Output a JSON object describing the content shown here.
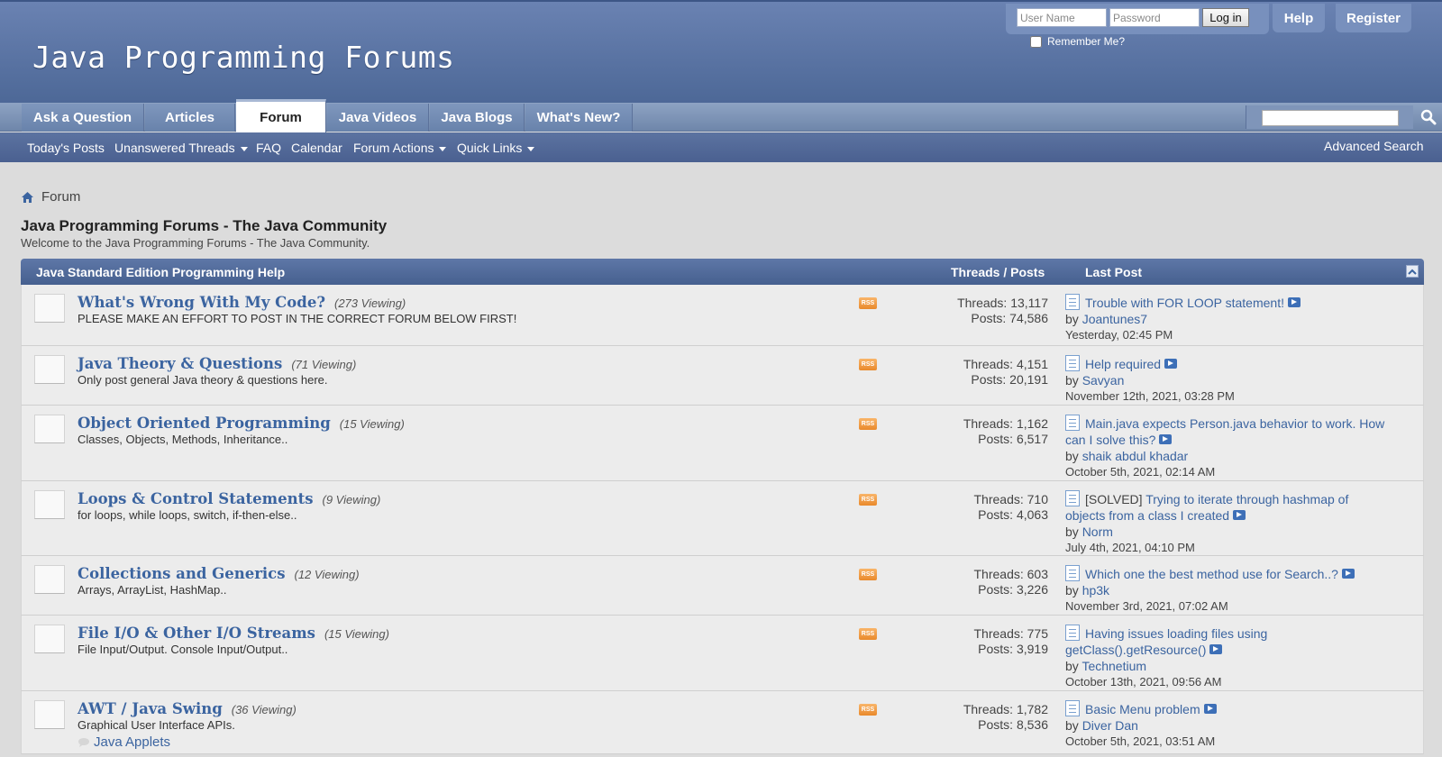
{
  "header": {
    "logo": "Java Programming Forums",
    "login": {
      "username_placeholder": "User Name",
      "password_placeholder": "Password",
      "login_label": "Log in",
      "remember_label": "Remember Me?"
    },
    "help_label": "Help",
    "register_label": "Register"
  },
  "nav": {
    "tabs": [
      {
        "label": "Ask a Question"
      },
      {
        "label": "Articles"
      },
      {
        "label": "Forum"
      },
      {
        "label": "Java Videos"
      },
      {
        "label": "Java Blogs"
      },
      {
        "label": "What's New?"
      }
    ],
    "selected_tab": "Forum"
  },
  "subnav": {
    "items": [
      {
        "label": "Today's Posts"
      },
      {
        "label": "Unanswered Threads"
      },
      {
        "label": "FAQ"
      },
      {
        "label": "Calendar"
      },
      {
        "label": "Forum Actions"
      },
      {
        "label": "Quick Links"
      }
    ],
    "advanced_search": "Advanced Search"
  },
  "breadcrumb": "Forum",
  "page": {
    "title": "Java Programming Forums - The Java Community",
    "subtitle": "Welcome to the Java Programming Forums - The Java Community."
  },
  "category": {
    "title": "Java Standard Edition Programming Help",
    "threads_posts_header": "Threads / Posts",
    "last_post_header": "Last Post"
  },
  "forums": [
    {
      "title": "What's Wrong With My Code?",
      "viewing": "(273 Viewing)",
      "desc": "PLEASE MAKE AN EFFORT TO POST IN THE CORRECT FORUM BELOW FIRST!",
      "subforum": "",
      "threads": "Threads: 13,117",
      "posts": "Posts: 74,586",
      "lp_prefix": "",
      "lp_title": "Trouble with FOR LOOP statement!",
      "lp_by": "by ",
      "lp_user": "Joantunes7",
      "lp_date": "Yesterday, 02:45 PM"
    },
    {
      "title": "Java Theory & Questions",
      "viewing": "(71 Viewing)",
      "desc": "Only post general Java theory & questions here.",
      "subforum": "",
      "threads": "Threads: 4,151",
      "posts": "Posts: 20,191",
      "lp_prefix": "",
      "lp_title": "Help required",
      "lp_by": "by ",
      "lp_user": "Savyan",
      "lp_date": "November 12th, 2021, 03:28 PM"
    },
    {
      "title": "Object Oriented Programming",
      "viewing": "(15 Viewing)",
      "desc": "Classes, Objects, Methods, Inheritance..",
      "subforum": "",
      "threads": "Threads: 1,162",
      "posts": "Posts: 6,517",
      "lp_prefix": "",
      "lp_title": "Main.java expects Person.java behavior to work. How can I solve this?",
      "lp_by": "by ",
      "lp_user": "shaik abdul khadar",
      "lp_date": "October 5th, 2021, 02:14 AM"
    },
    {
      "title": "Loops & Control Statements",
      "viewing": "(9 Viewing)",
      "desc": "for loops, while loops, switch, if-then-else..",
      "subforum": "",
      "threads": "Threads: 710",
      "posts": "Posts: 4,063",
      "lp_prefix": "[SOLVED] ",
      "lp_title": "Trying to iterate through hashmap of objects from a class I created",
      "lp_by": "by ",
      "lp_user": "Norm",
      "lp_date": "July 4th, 2021, 04:10 PM"
    },
    {
      "title": "Collections and Generics",
      "viewing": "(12 Viewing)",
      "desc": "Arrays, ArrayList, HashMap..",
      "subforum": "",
      "threads": "Threads: 603",
      "posts": "Posts: 3,226",
      "lp_prefix": "",
      "lp_title": "Which one the best method use for Search..?",
      "lp_by": "by ",
      "lp_user": "hp3k",
      "lp_date": "November 3rd, 2021, 07:02 AM"
    },
    {
      "title": "File I/O & Other I/O Streams",
      "viewing": "(15 Viewing)",
      "desc": "File Input/Output. Console Input/Output..",
      "subforum": "",
      "threads": "Threads: 775",
      "posts": "Posts: 3,919",
      "lp_prefix": "",
      "lp_title": "Having issues loading files using getClass().getResource()",
      "lp_by": "by ",
      "lp_user": "Technetium",
      "lp_date": "October 13th, 2021, 09:56 AM"
    },
    {
      "title": "AWT / Java Swing",
      "viewing": "(36 Viewing)",
      "desc": "Graphical User Interface APIs.",
      "subforum": "Java Applets",
      "threads": "Threads: 1,782",
      "posts": "Posts: 8,536",
      "lp_prefix": "",
      "lp_title": "Basic Menu problem",
      "lp_by": "by ",
      "lp_user": "Diver Dan",
      "lp_date": "October 5th, 2021, 03:51 AM"
    }
  ],
  "icons": {
    "rss": "rss-icon",
    "rss_text": "RSS",
    "home": "home-icon",
    "search": "search-icon",
    "post": "post-icon",
    "goto": "goto-last-post-icon"
  },
  "colors": {
    "header": "#5a73a3",
    "link": "#3b64a0",
    "rss": "#e9892b"
  }
}
